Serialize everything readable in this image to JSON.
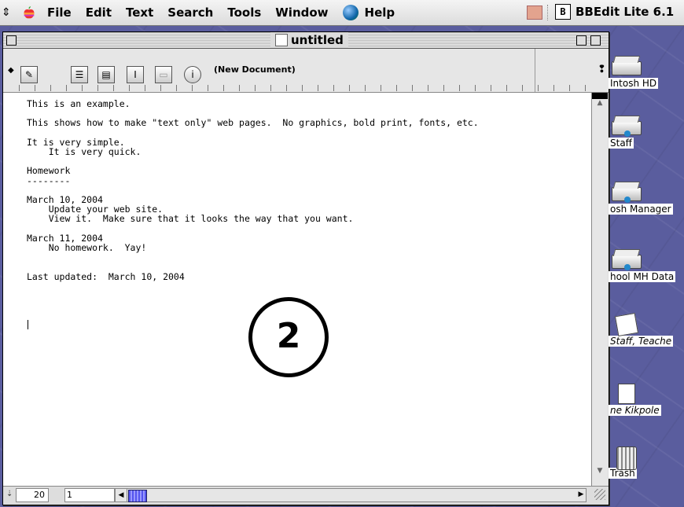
{
  "menubar": {
    "strip_glyph": "⇕",
    "items": [
      "File",
      "Edit",
      "Text",
      "Search",
      "Tools",
      "Window",
      "Help"
    ],
    "app_name": "BBEdit Lite 6.1",
    "app_letter": "B"
  },
  "window": {
    "title": "untitled",
    "status": "(New Document)",
    "mark_glyph": "❢"
  },
  "document": {
    "text": "This is an example.\n\nThis shows how to make \"text only\" web pages.  No graphics, bold print, fonts, etc.\n\nIt is very simple.\n    It is very quick.\n\nHomework\n--------\n\nMarch 10, 2004\n    Update your web site.\n    View it.  Make sure that it looks the way that you want.\n\nMarch 11, 2004\n    No homework.  Yay!\n\n\nLast updated:  March 10, 2004"
  },
  "statusbar": {
    "line": "20",
    "column": "1"
  },
  "desktop_icons": [
    {
      "label": "Intosh HD"
    },
    {
      "label": "Staff"
    },
    {
      "label": "osh Manager"
    },
    {
      "label": "hool MH Data"
    },
    {
      "label": "Staff, Teache"
    },
    {
      "label": "ne Kikpole"
    },
    {
      "label": "Trash"
    }
  ],
  "badge": {
    "number": "2"
  }
}
